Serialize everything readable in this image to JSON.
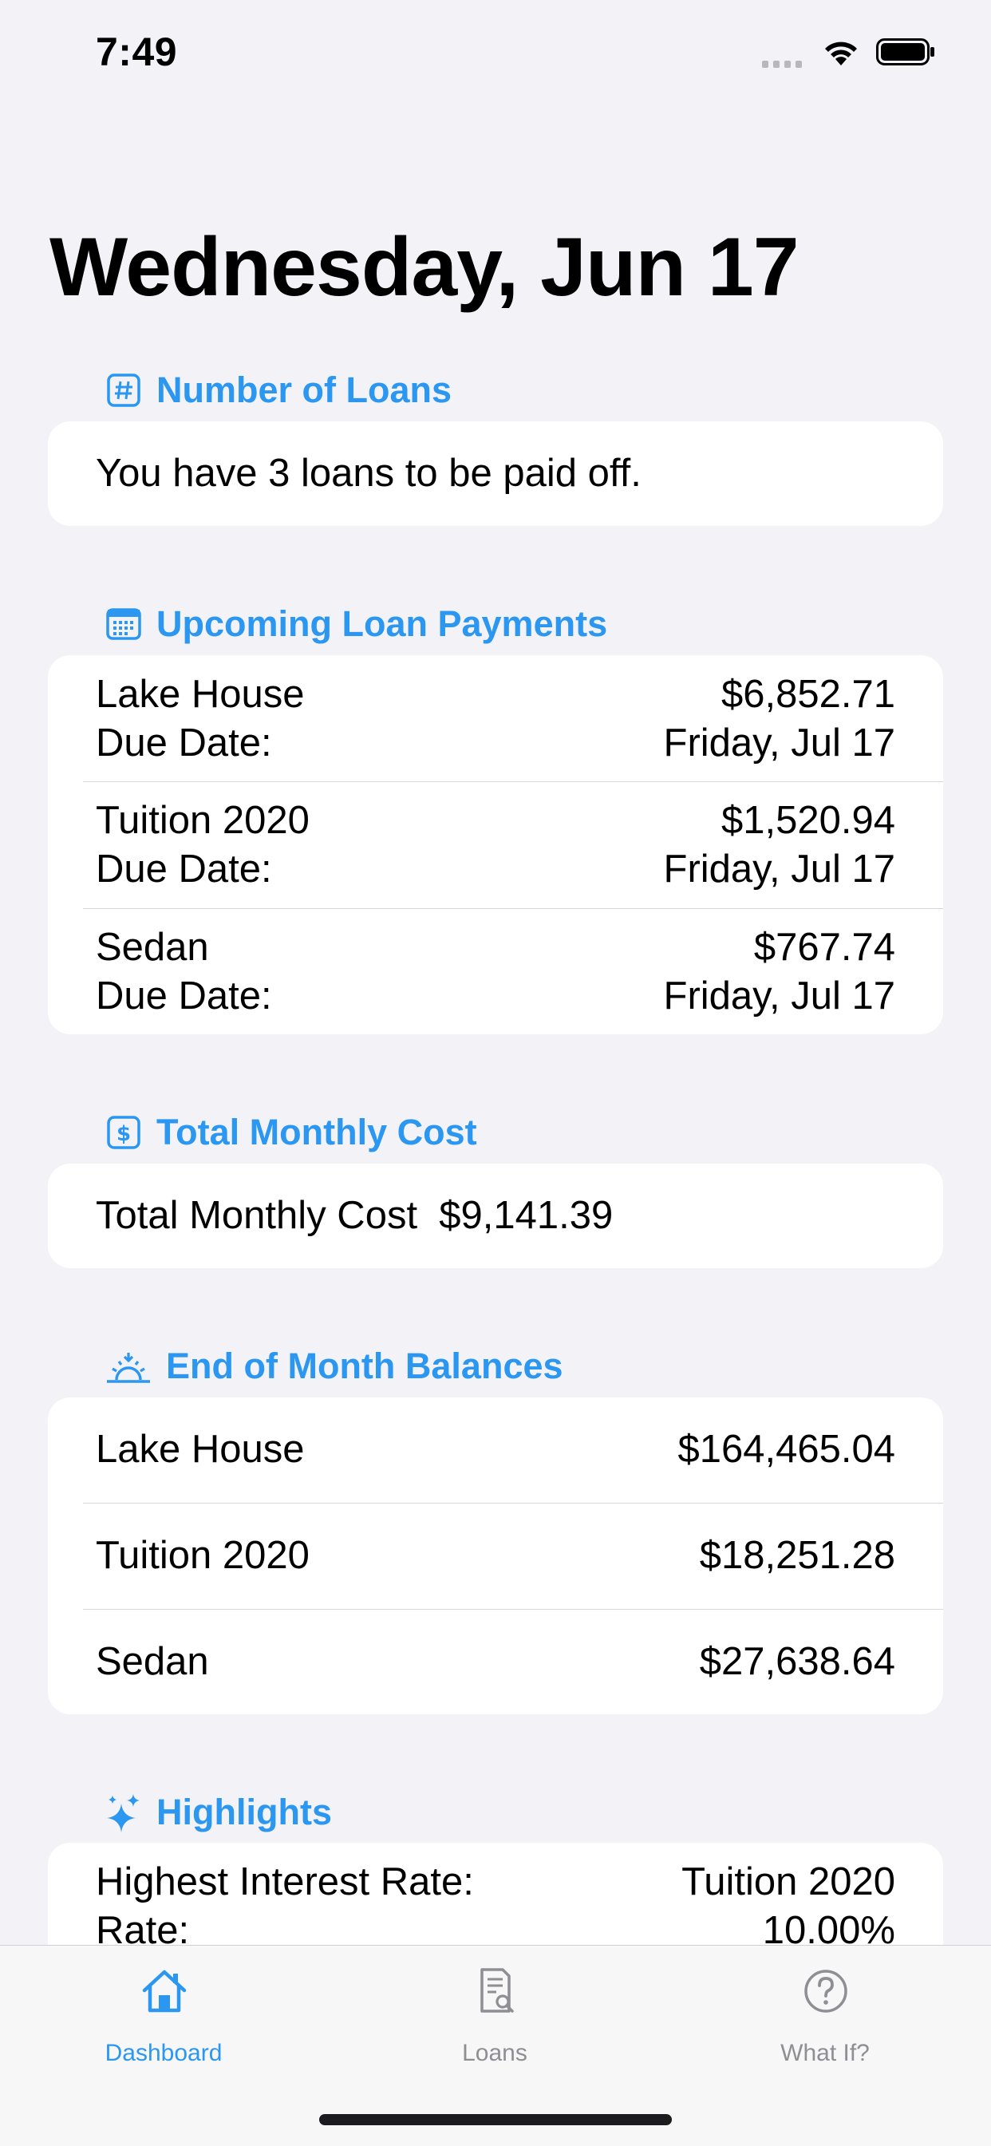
{
  "status_bar": {
    "time": "7:49"
  },
  "title": "Wednesday, Jun 17",
  "sections": {
    "number_of_loans": {
      "header": "Number of Loans",
      "text": "You have 3 loans to be paid off."
    },
    "upcoming_payments": {
      "header": "Upcoming Loan Payments",
      "items": [
        {
          "name": "Lake House",
          "amount": "$6,852.71",
          "due_label": "Due Date:",
          "due": "Friday, Jul 17"
        },
        {
          "name": "Tuition 2020",
          "amount": "$1,520.94",
          "due_label": "Due Date:",
          "due": "Friday, Jul 17"
        },
        {
          "name": "Sedan",
          "amount": "$767.74",
          "due_label": "Due Date:",
          "due": "Friday, Jul 17"
        }
      ]
    },
    "total_monthly_cost": {
      "header": "Total Monthly Cost",
      "label": "Total Monthly Cost",
      "value": "$9,141.39"
    },
    "end_of_month_balances": {
      "header": "End of Month Balances",
      "items": [
        {
          "name": "Lake House",
          "balance": "$164,465.04"
        },
        {
          "name": "Tuition 2020",
          "balance": "$18,251.28"
        },
        {
          "name": "Sedan",
          "balance": "$27,638.64"
        }
      ]
    },
    "highlights": {
      "header": "Highlights",
      "items": [
        {
          "label": "Highest Interest Rate:",
          "value": "Tuition 2020",
          "sub_label": "Rate:",
          "sub_value": "10.00%"
        }
      ]
    }
  },
  "tab_bar": {
    "tabs": [
      {
        "label": "Dashboard",
        "icon": "house-icon",
        "active": true
      },
      {
        "label": "Loans",
        "icon": "document-search-icon",
        "active": false
      },
      {
        "label": "What If?",
        "icon": "question-circle-icon",
        "active": false
      }
    ]
  },
  "colors": {
    "accent": "#2b97f0",
    "background": "#f2f2f7",
    "inactive_tab": "#8e8e93"
  }
}
